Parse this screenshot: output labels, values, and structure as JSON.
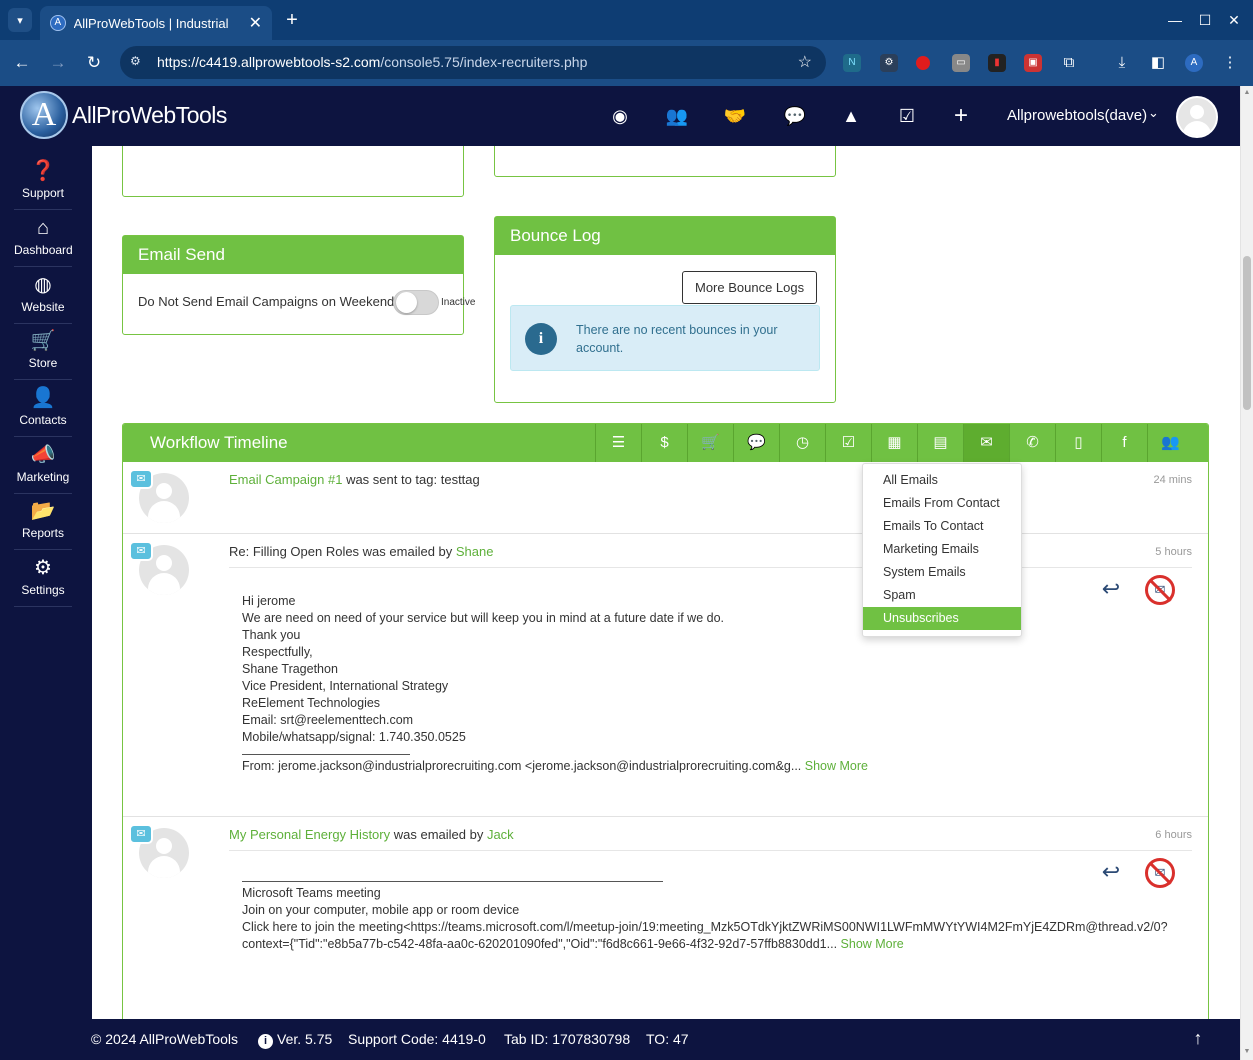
{
  "browser": {
    "tab_title": "AllProWebTools | Industrial",
    "url_host": "https://c4419.allprowebtools-s2.com",
    "url_path": "/console5.75/index-recruiters.php"
  },
  "header": {
    "logo_text": "AllProWebTools",
    "user_name": "Allprowebtools(dave)"
  },
  "sidebar": {
    "items": [
      {
        "label": "Support",
        "icon": "question-icon"
      },
      {
        "label": "Dashboard",
        "icon": "home-icon"
      },
      {
        "label": "Website",
        "icon": "globe-icon"
      },
      {
        "label": "Store",
        "icon": "cart-icon"
      },
      {
        "label": "Contacts",
        "icon": "user-icon"
      },
      {
        "label": "Marketing",
        "icon": "megaphone-icon"
      },
      {
        "label": "Reports",
        "icon": "folder-icon"
      },
      {
        "label": "Settings",
        "icon": "gear-icon"
      }
    ]
  },
  "email_send": {
    "title": "Email Send",
    "label": "Do Not Send Email Campaigns on Weekends:",
    "toggle_state": "Inactive"
  },
  "bounce_log": {
    "title": "Bounce Log",
    "button": "More Bounce Logs",
    "message": "There are no recent bounces in your account."
  },
  "workflow": {
    "title": "Workflow Timeline",
    "entries": [
      {
        "link": "Email Campaign #1",
        "text": " was sent to tag: testtag",
        "time": "24 mins"
      },
      {
        "prefix": "Re: Filling Open Roles was emailed by ",
        "person": "Shane",
        "time": "5 hours",
        "body": [
          "Hi jerome",
          "We are need on need of your service but will keep you in mind at a future date if we do.",
          "Thank you",
          "Respectfully,",
          "Shane Tragethon",
          "Vice President, International Strategy",
          "ReElement Technologies",
          "Email: srt@reelementtech.com",
          "Mobile/whatsapp/signal: 1.740.350.0525"
        ],
        "from_line": "From: jerome.jackson@industrialprorecruiting.com <jerome.jackson@industrialprorecruiting.com&g...",
        "show_more": "Show More"
      },
      {
        "link": "My Personal Energy History",
        "text": " was emailed by ",
        "person": "Jack",
        "time": "6 hours",
        "body": [
          "Microsoft Teams meeting",
          "Join on your computer, mobile app or room device",
          "Click here to join the meeting<https://teams.microsoft.com/l/meetup-join/19:meeting_Mzk5OTdkYjktZWRiMS00NWI1LWFmMWYtYWI4M2FmYjE4ZDRm@thread.v2/0?",
          "context={\"Tid\":\"e8b5a77b-c542-48fa-aa0c-620201090fed\",\"Oid\":\"f6d8c661-9e66-4f32-92d7-57ffb8830dd1..."
        ],
        "show_more": "Show More"
      }
    ]
  },
  "email_filter_menu": {
    "items": [
      "All Emails",
      "Emails From Contact",
      "Emails To Contact",
      "Marketing Emails",
      "System Emails",
      "Spam",
      "Unsubscribes"
    ],
    "selected": "Unsubscribes"
  },
  "footer": {
    "copyright": "© 2024 AllProWebTools",
    "version": "Ver. 5.75",
    "support_code": "Support Code: 4419-0",
    "tab_id": "Tab ID: 1707830798",
    "to": "TO: 47"
  },
  "colors": {
    "brand_navy": "#0d1440",
    "accent_green": "#70c143",
    "link_green": "#5eb03a",
    "info_blue": "#d9edf7"
  }
}
